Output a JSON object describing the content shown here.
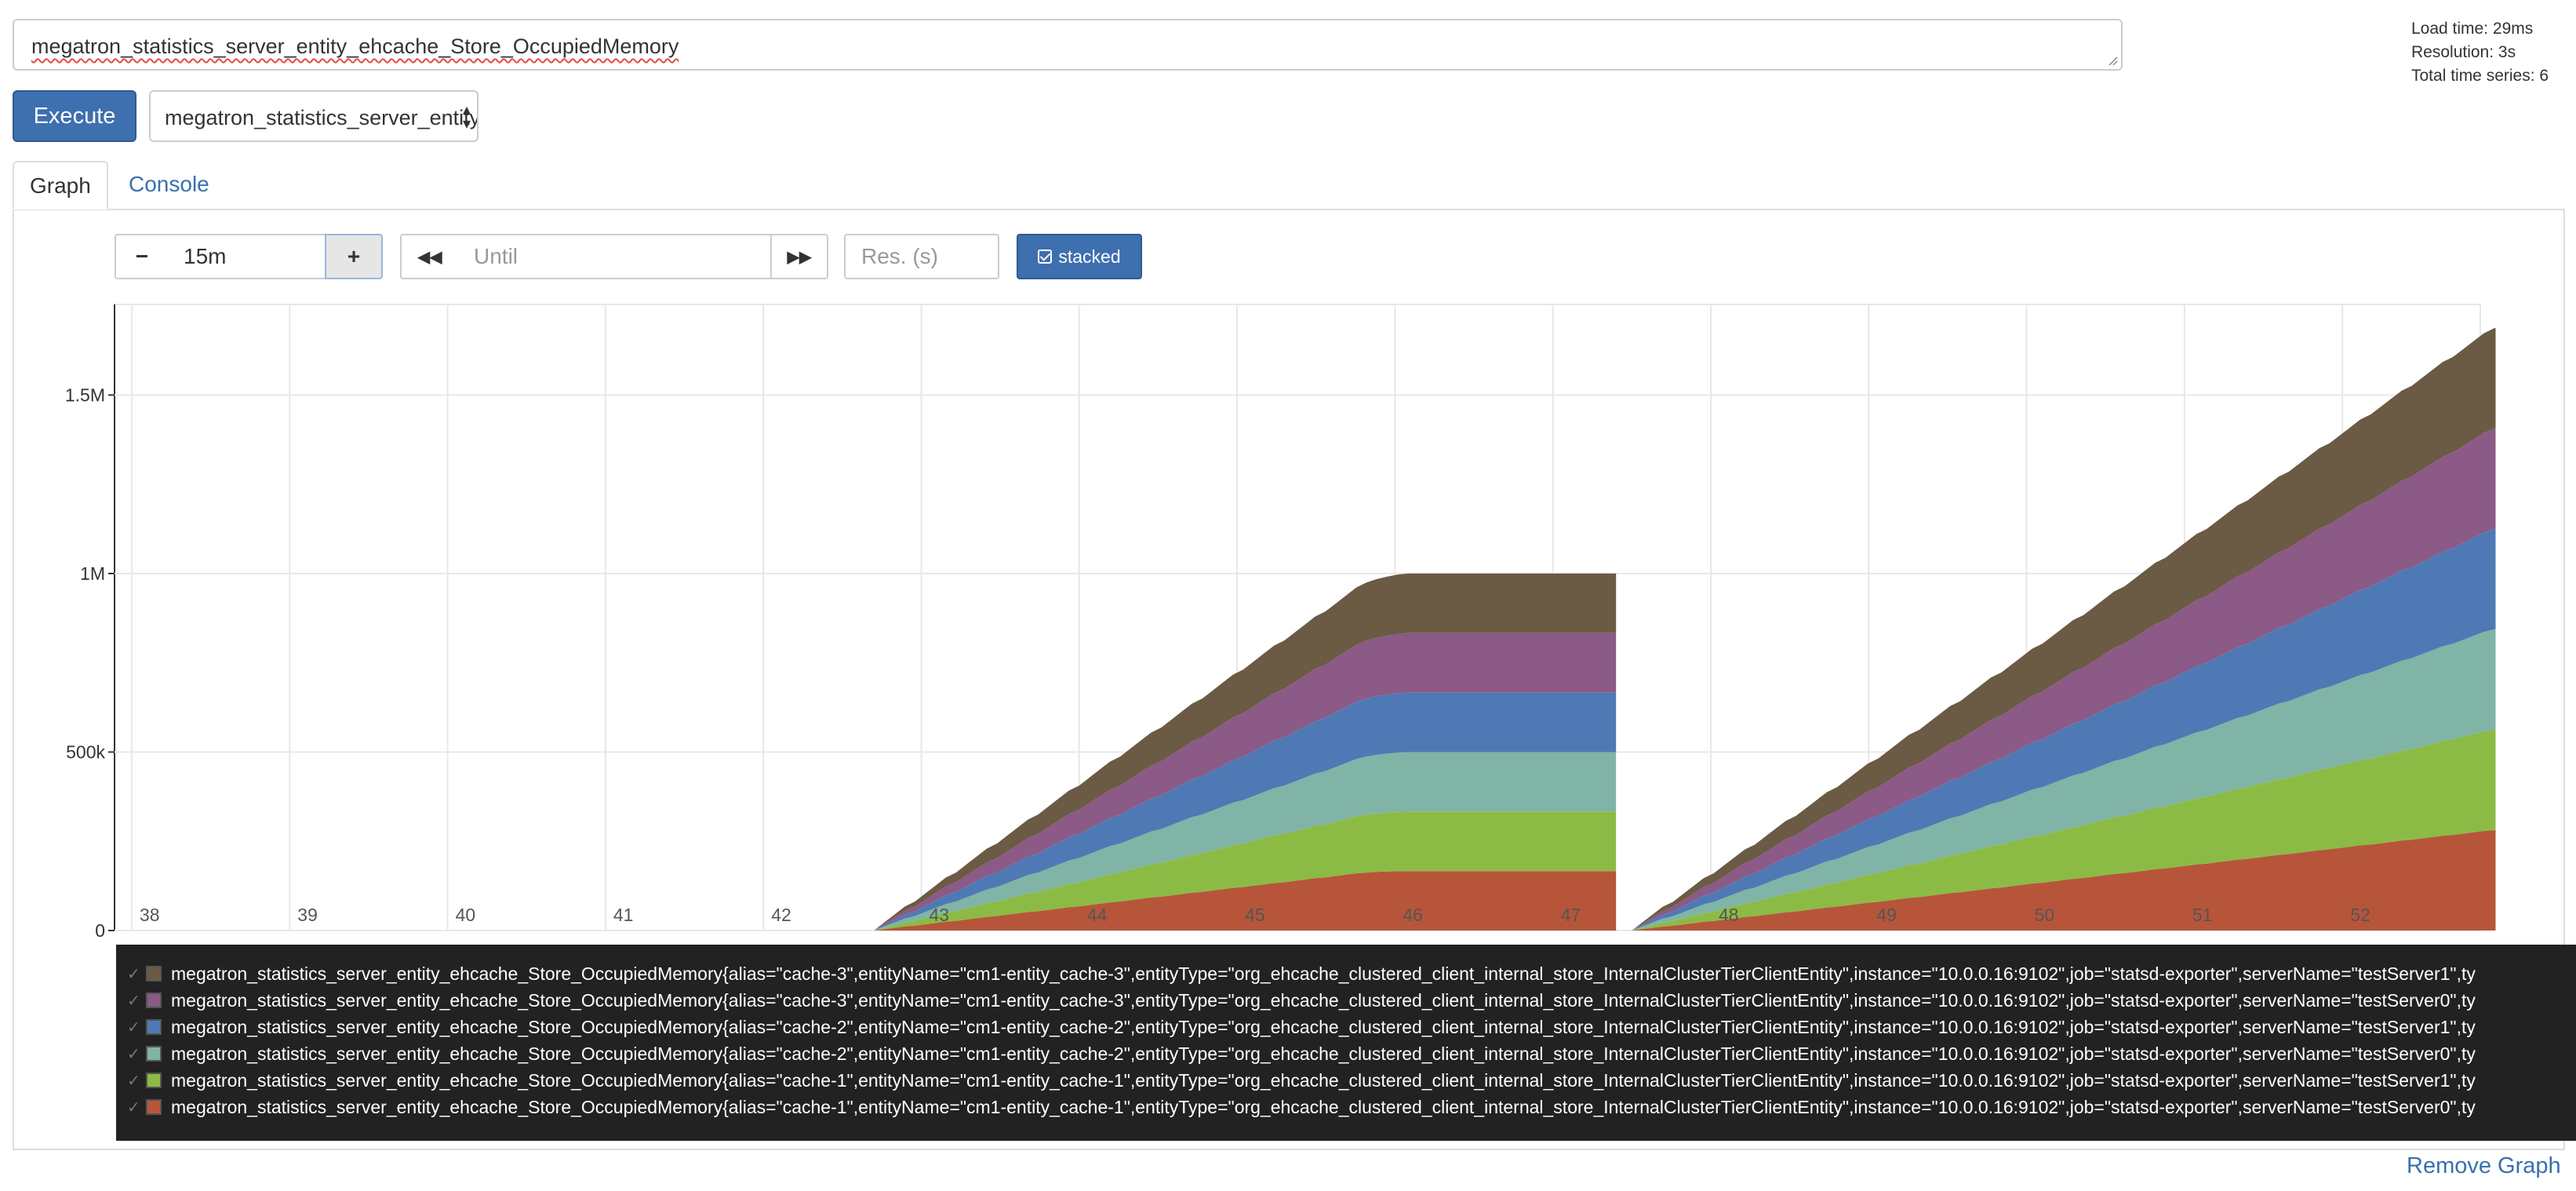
{
  "query": {
    "expression": "megatron_statistics_server_entity_ehcache_Store_OccupiedMemory",
    "execute_label": "Execute",
    "metric_select_value": "megatron_statistics_server_entity_ehcache_Store_OccupiedMemory"
  },
  "stats": {
    "load_time": "Load time: 29ms",
    "resolution": "Resolution: 3s",
    "total_series": "Total time series: 6"
  },
  "tabs": {
    "graph": "Graph",
    "console": "Console"
  },
  "controls": {
    "minus": "−",
    "range": "15m",
    "plus": "+",
    "back": "◀◀",
    "until_placeholder": "Until",
    "forward": "▶▶",
    "res_placeholder": "Res. (s)",
    "stacked_label": "stacked"
  },
  "chart_data": {
    "type": "area",
    "stacked": true,
    "x_tick_labels": [
      "38",
      "39",
      "40",
      "41",
      "42",
      "43",
      "44",
      "45",
      "46",
      "47",
      "48",
      "49",
      "50",
      "51",
      "52"
    ],
    "y_tick_labels": [
      "0",
      "500k",
      "1M",
      "1.5M"
    ],
    "ylim": [
      0,
      1750000
    ],
    "grid": true,
    "series": [
      {
        "name": "megatron_statistics_server_entity_ehcache_Store_OccupiedMemory{alias=\"cache-1\",entityName=\"cm1-entity_cache-1\",entityType=\"org_ehcache_clustered_client_internal_store_InternalClusterTierClientEntity\",instance=\"10.0.0.16:9102\",job=\"statsd-exporter\",serverName=\"testServer0\",ty",
        "color": "#b7553a",
        "peak_segment_1": 167000,
        "final_value": 283000
      },
      {
        "name": "megatron_statistics_server_entity_ehcache_Store_OccupiedMemory{alias=\"cache-1\",entityName=\"cm1-entity_cache-1\",entityType=\"org_ehcache_clustered_client_internal_store_InternalClusterTierClientEntity\",instance=\"10.0.0.16:9102\",job=\"statsd-exporter\",serverName=\"testServer1\",ty",
        "color": "#8bbb45",
        "peak_segment_1": 167000,
        "final_value": 283000
      },
      {
        "name": "megatron_statistics_server_entity_ehcache_Store_OccupiedMemory{alias=\"cache-2\",entityName=\"cm1-entity_cache-2\",entityType=\"org_ehcache_clustered_client_internal_store_InternalClusterTierClientEntity\",instance=\"10.0.0.16:9102\",job=\"statsd-exporter\",serverName=\"testServer0\",ty",
        "color": "#80b4a6",
        "peak_segment_1": 167000,
        "final_value": 283000
      },
      {
        "name": "megatron_statistics_server_entity_ehcache_Store_OccupiedMemory{alias=\"cache-2\",entityName=\"cm1-entity_cache-2\",entityType=\"org_ehcache_clustered_client_internal_store_InternalClusterTierClientEntity\",instance=\"10.0.0.16:9102\",job=\"statsd-exporter\",serverName=\"testServer1\",ty",
        "color": "#4f79b4",
        "peak_segment_1": 167000,
        "final_value": 283000
      },
      {
        "name": "megatron_statistics_server_entity_ehcache_Store_OccupiedMemory{alias=\"cache-3\",entityName=\"cm1-entity_cache-3\",entityType=\"org_ehcache_clustered_client_internal_store_InternalClusterTierClientEntity\",instance=\"10.0.0.16:9102\",job=\"statsd-exporter\",serverName=\"testServer0\",ty",
        "color": "#8b5a86",
        "peak_segment_1": 167000,
        "final_value": 283000
      },
      {
        "name": "megatron_statistics_server_entity_ehcache_Store_OccupiedMemory{alias=\"cache-3\",entityName=\"cm1-entity_cache-3\",entityType=\"org_ehcache_clustered_client_internal_store_InternalClusterTierClientEntity\",instance=\"10.0.0.16:9102\",job=\"statsd-exporter\",serverName=\"testServer1\",ty",
        "color": "#6b5a44",
        "peak_segment_1": 167000,
        "final_value": 283000
      }
    ],
    "segments": [
      {
        "start_minute": 42.7,
        "end_minute": 47.4,
        "plateau_from_minute": 45.9,
        "total_peak": 1000000
      },
      {
        "start_minute": 47.5,
        "end_minute": 52.97,
        "total_final": 1690000
      }
    ]
  },
  "remove_graph": "Remove Graph"
}
